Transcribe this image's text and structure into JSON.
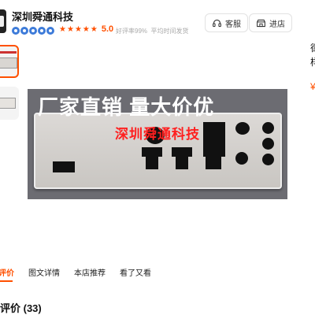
{
  "shop": {
    "name": "深圳舜通科技",
    "rating": "5.0",
    "good_rate": "好评率99%",
    "ship_time": "平均时间发货"
  },
  "header_buttons": [
    {
      "label": "客服",
      "icon": "headset-icon"
    },
    {
      "label": "进店",
      "icon": "store-icon"
    }
  ],
  "product_image": {
    "headline": "厂家直销 量大价优",
    "watermark": "深圳舜通科技"
  },
  "tabs": [
    "评价",
    "图文详情",
    "本店推荐",
    "看了又看"
  ],
  "reviews": {
    "title": "评价 (33)"
  },
  "edge_text": [
    "德",
    "样",
    "¥"
  ],
  "colors": {
    "accent": "#ff5000",
    "badge": "#3d7bd9"
  }
}
